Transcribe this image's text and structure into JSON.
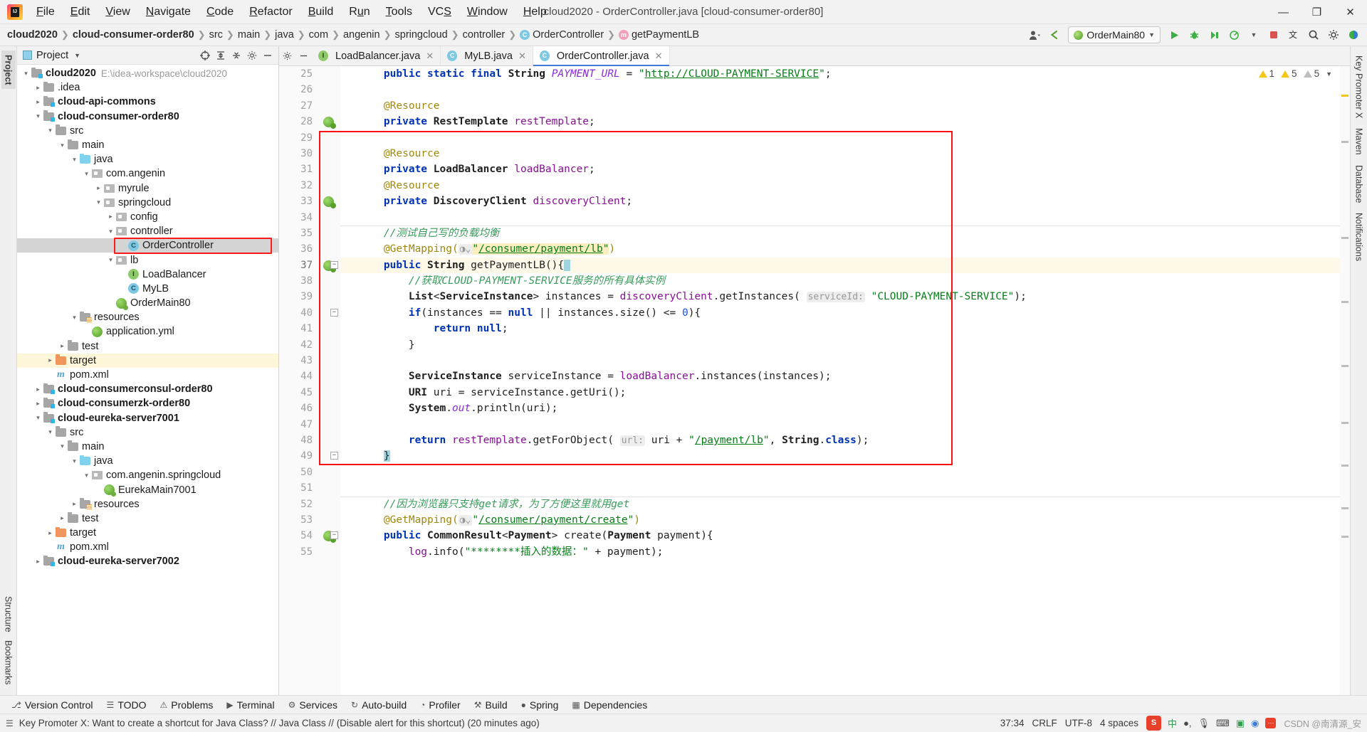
{
  "window": {
    "title": "cloud2020 - OrderController.java [cloud-consumer-order80]",
    "app_icon": "intellij-idea-logo",
    "minimize_label": "—",
    "restore_label": "❐",
    "close_label": "✕"
  },
  "menubar": [
    {
      "label": "File"
    },
    {
      "label": "Edit"
    },
    {
      "label": "View"
    },
    {
      "label": "Navigate"
    },
    {
      "label": "Code"
    },
    {
      "label": "Refactor"
    },
    {
      "label": "Build"
    },
    {
      "label": "Run"
    },
    {
      "label": "Tools"
    },
    {
      "label": "VCS"
    },
    {
      "label": "Window"
    },
    {
      "label": "Help"
    }
  ],
  "breadcrumb": [
    {
      "label": "cloud2020",
      "bold": true,
      "icon": ""
    },
    {
      "label": "cloud-consumer-order80",
      "bold": true,
      "icon": ""
    },
    {
      "label": "src",
      "bold": false,
      "icon": ""
    },
    {
      "label": "main",
      "bold": false,
      "icon": ""
    },
    {
      "label": "java",
      "bold": false,
      "icon": ""
    },
    {
      "label": "com",
      "bold": false,
      "icon": ""
    },
    {
      "label": "angenin",
      "bold": false,
      "icon": ""
    },
    {
      "label": "springcloud",
      "bold": false,
      "icon": ""
    },
    {
      "label": "controller",
      "bold": false,
      "icon": ""
    },
    {
      "label": "OrderController",
      "bold": false,
      "icon": "class-icon"
    },
    {
      "label": "getPaymentLB",
      "bold": false,
      "icon": "method-icon"
    }
  ],
  "toolbar": {
    "run_config": "OrderMain80",
    "run_label": "run-button",
    "debug_label": "debug-button",
    "coverage_label": "run-with-coverage-button",
    "profile_label": "profiler-button",
    "stop_label": "stop-button",
    "translate_label": "translate-button",
    "search_label": "search-everywhere-button",
    "settings_label": "settings-button",
    "user_label": "user-account-button",
    "updates_label": "updates-button"
  },
  "left_strip": {
    "tabs": [
      {
        "label": "Project",
        "active": true
      }
    ],
    "bottom": [
      {
        "label": "Bookmarks"
      },
      {
        "label": "Structure"
      }
    ]
  },
  "right_strip": {
    "tabs": [
      {
        "label": "Key Promoter X"
      },
      {
        "label": "Maven"
      },
      {
        "label": "Database"
      },
      {
        "label": "Notifications"
      }
    ]
  },
  "project_panel": {
    "title": "Project",
    "tools": [
      "target-icon",
      "expand-all-icon",
      "collapse-all-icon",
      "gear-icon",
      "hide-icon"
    ],
    "tree": [
      {
        "depth": 0,
        "arrow": "down",
        "icon": "module-folder",
        "label": "cloud2020",
        "bold": true,
        "sub": "E:\\idea-workspace\\cloud2020"
      },
      {
        "depth": 1,
        "arrow": "right",
        "icon": "folder",
        "label": ".idea",
        "bold": false,
        "sub": ""
      },
      {
        "depth": 1,
        "arrow": "right",
        "icon": "module-folder",
        "label": "cloud-api-commons",
        "bold": true,
        "sub": ""
      },
      {
        "depth": 1,
        "arrow": "down",
        "icon": "module-folder",
        "label": "cloud-consumer-order80",
        "bold": true,
        "sub": ""
      },
      {
        "depth": 2,
        "arrow": "down",
        "icon": "folder",
        "label": "src",
        "bold": false,
        "sub": ""
      },
      {
        "depth": 3,
        "arrow": "down",
        "icon": "folder",
        "label": "main",
        "bold": false,
        "sub": ""
      },
      {
        "depth": 4,
        "arrow": "down",
        "icon": "source-folder",
        "label": "java",
        "bold": false,
        "sub": ""
      },
      {
        "depth": 5,
        "arrow": "down",
        "icon": "package",
        "label": "com.angenin",
        "bold": false,
        "sub": ""
      },
      {
        "depth": 6,
        "arrow": "right",
        "icon": "package",
        "label": "myrule",
        "bold": false,
        "sub": ""
      },
      {
        "depth": 6,
        "arrow": "down",
        "icon": "package",
        "label": "springcloud",
        "bold": false,
        "sub": ""
      },
      {
        "depth": 7,
        "arrow": "right",
        "icon": "package",
        "label": "config",
        "bold": false,
        "sub": ""
      },
      {
        "depth": 7,
        "arrow": "down",
        "icon": "package",
        "label": "controller",
        "bold": false,
        "sub": ""
      },
      {
        "depth": 8,
        "arrow": "none",
        "icon": "class",
        "label": "OrderController",
        "bold": false,
        "sub": "",
        "selected": true,
        "outlined": true
      },
      {
        "depth": 7,
        "arrow": "down",
        "icon": "package",
        "label": "lb",
        "bold": false,
        "sub": ""
      },
      {
        "depth": 8,
        "arrow": "none",
        "icon": "interface",
        "label": "LoadBalancer",
        "bold": false,
        "sub": ""
      },
      {
        "depth": 8,
        "arrow": "none",
        "icon": "class",
        "label": "MyLB",
        "bold": false,
        "sub": ""
      },
      {
        "depth": 7,
        "arrow": "none",
        "icon": "spring-class",
        "label": "OrderMain80",
        "bold": false,
        "sub": ""
      },
      {
        "depth": 4,
        "arrow": "down",
        "icon": "resource-folder",
        "label": "resources",
        "bold": false,
        "sub": ""
      },
      {
        "depth": 5,
        "arrow": "none",
        "icon": "yml",
        "label": "application.yml",
        "bold": false,
        "sub": ""
      },
      {
        "depth": 3,
        "arrow": "right",
        "icon": "folder",
        "label": "test",
        "bold": false,
        "sub": ""
      },
      {
        "depth": 2,
        "arrow": "right",
        "icon": "folder-orange",
        "label": "target",
        "bold": false,
        "sub": "",
        "highlighted": true
      },
      {
        "depth": 2,
        "arrow": "none",
        "icon": "maven",
        "label": "pom.xml",
        "bold": false,
        "sub": ""
      },
      {
        "depth": 1,
        "arrow": "right",
        "icon": "module-folder",
        "label": "cloud-consumerconsul-order80",
        "bold": true,
        "sub": ""
      },
      {
        "depth": 1,
        "arrow": "right",
        "icon": "module-folder",
        "label": "cloud-consumerzk-order80",
        "bold": true,
        "sub": ""
      },
      {
        "depth": 1,
        "arrow": "down",
        "icon": "module-folder",
        "label": "cloud-eureka-server7001",
        "bold": true,
        "sub": ""
      },
      {
        "depth": 2,
        "arrow": "down",
        "icon": "folder",
        "label": "src",
        "bold": false,
        "sub": ""
      },
      {
        "depth": 3,
        "arrow": "down",
        "icon": "folder",
        "label": "main",
        "bold": false,
        "sub": ""
      },
      {
        "depth": 4,
        "arrow": "down",
        "icon": "source-folder",
        "label": "java",
        "bold": false,
        "sub": ""
      },
      {
        "depth": 5,
        "arrow": "down",
        "icon": "package",
        "label": "com.angenin.springcloud",
        "bold": false,
        "sub": ""
      },
      {
        "depth": 6,
        "arrow": "none",
        "icon": "spring-class",
        "label": "EurekaMain7001",
        "bold": false,
        "sub": ""
      },
      {
        "depth": 4,
        "arrow": "right",
        "icon": "resource-folder",
        "label": "resources",
        "bold": false,
        "sub": ""
      },
      {
        "depth": 3,
        "arrow": "right",
        "icon": "folder",
        "label": "test",
        "bold": false,
        "sub": ""
      },
      {
        "depth": 2,
        "arrow": "right",
        "icon": "folder-orange",
        "label": "target",
        "bold": false,
        "sub": ""
      },
      {
        "depth": 2,
        "arrow": "none",
        "icon": "maven",
        "label": "pom.xml",
        "bold": false,
        "sub": ""
      },
      {
        "depth": 1,
        "arrow": "right",
        "icon": "module-folder",
        "label": "cloud-eureka-server7002",
        "bold": true,
        "sub": ""
      }
    ]
  },
  "editor": {
    "tabs": [
      {
        "label": "LoadBalancer.java",
        "icon": "interface-icon",
        "active": false
      },
      {
        "label": "MyLB.java",
        "icon": "class-icon",
        "active": false
      },
      {
        "label": "OrderController.java",
        "icon": "class-icon",
        "active": true
      }
    ],
    "inspections": {
      "warnings": "1",
      "weak_warnings": "5",
      "greyed": "5",
      "chevron": "⌄"
    },
    "first_line_number": 25,
    "current_line": 37,
    "lines": [
      {
        "n": 25,
        "html": "    <span class=\"kw\">public</span> <span class=\"kw\">static</span> <span class=\"kw\">final</span> <span class=\"typ\">String</span> <span class=\"cnst\">PAYMENT_URL</span> = <span class=\"str\">\"</span><span class=\"strlink\">http://CLOUD-PAYMENT-SERVICE</span><span class=\"str\">\"</span>;"
      },
      {
        "n": 26,
        "html": ""
      },
      {
        "n": 27,
        "html": "    <span class=\"ann\">@Resource</span>"
      },
      {
        "n": 28,
        "html": "    <span class=\"kw\">private</span> <span class=\"typ\">RestTemplate</span> <span class=\"fld2\">restTemplate</span>;",
        "gutter_icon": "spring-bean"
      },
      {
        "n": 29,
        "html": ""
      },
      {
        "n": 30,
        "html": "    <span class=\"ann\">@Resource</span>"
      },
      {
        "n": 31,
        "html": "    <span class=\"kw\">private</span> <span class=\"typ\">LoadBalancer</span> <span class=\"fld2\">loadBalancer</span>;"
      },
      {
        "n": 32,
        "html": "    <span class=\"ann\">@Resource</span>"
      },
      {
        "n": 33,
        "html": "    <span class=\"kw\">private</span> <span class=\"typ\">DiscoveryClient</span> <span class=\"fld2\">discoveryClient</span>;",
        "gutter_icon": "spring-bean"
      },
      {
        "n": 34,
        "html": ""
      },
      {
        "n": 35,
        "html": "    <span class=\"cmt-cn\">//测试自己写的负载均衡</span>",
        "sep_above": true
      },
      {
        "n": 36,
        "html": "    <span class=\"ann\">@GetMapping(</span><span class=\"param-hint\">◑⌄</span><span class=\"hl-yellow\"><span class=\"str\">\"</span><span class=\"strlink\">/consumer/payment/lb</span><span class=\"str\">\"</span></span><span class=\"ann\">)</span>"
      },
      {
        "n": 37,
        "html": "    <span class=\"kw\">public</span> <span class=\"typ\">String</span> <span class=\"mtd\">getPaymentLB</span>(){<span class=\"caretmark\"> </span>",
        "gutter_icon": "spring-url",
        "fold": true,
        "current": true
      },
      {
        "n": 38,
        "html": "        <span class=\"cmt-cn\">//获取CLOUD-PAYMENT-SERVICE服务的所有具体实例</span>"
      },
      {
        "n": 39,
        "html": "        <span class=\"typ\">List</span>&lt;<span class=\"typ\">ServiceInstance</span>&gt; instances = <span class=\"fld2\">discoveryClient</span>.getInstances( <span class=\"param-hint\">serviceId:</span> <span class=\"str\">\"CLOUD-PAYMENT-SERVICE\"</span>);"
      },
      {
        "n": 40,
        "html": "        <span class=\"kw\">if</span>(instances == <span class=\"kw\">null</span> || instances.size() &lt;= <span class=\"num\">0</span>){",
        "fold": true
      },
      {
        "n": 41,
        "html": "            <span class=\"kw\">return</span> <span class=\"kw\">null</span>;"
      },
      {
        "n": 42,
        "html": "        }"
      },
      {
        "n": 43,
        "html": ""
      },
      {
        "n": 44,
        "html": "        <span class=\"typ\">ServiceInstance</span> serviceInstance = <span class=\"fld2\">loadBalancer</span>.instances(instances);"
      },
      {
        "n": 45,
        "html": "        <span class=\"typ\">URI</span> uri = serviceInstance.getUri();"
      },
      {
        "n": 46,
        "html": "        <span class=\"typ\">System</span>.<span class=\"cnst\">out</span>.println(uri);"
      },
      {
        "n": 47,
        "html": ""
      },
      {
        "n": 48,
        "html": "        <span class=\"kw\">return</span> <span class=\"fld2\">restTemplate</span>.getForObject( <span class=\"param-hint\">url:</span> uri + <span class=\"str\">\"</span><span class=\"strlink\">/payment/lb</span><span class=\"str\">\"</span>, <span class=\"typ\">String</span>.<span class=\"kw\">class</span>);"
      },
      {
        "n": 49,
        "html": "    <span class=\"brace-hl\">}</span>",
        "fold": true
      },
      {
        "n": 50,
        "html": ""
      },
      {
        "n": 51,
        "html": ""
      },
      {
        "n": 52,
        "html": "    <span class=\"cmt-cn\">//因为浏览器只支持get请求，为了方便这里就用get</span>",
        "sep_above": true
      },
      {
        "n": 53,
        "html": "    <span class=\"ann\">@GetMapping(</span><span class=\"param-hint\">◑⌄</span><span class=\"str\">\"</span><span class=\"strlink\">/consumer/payment/create</span><span class=\"str\">\"</span><span class=\"ann\">)</span>"
      },
      {
        "n": 54,
        "html": "    <span class=\"kw\">public</span> <span class=\"typ\">CommonResult</span>&lt;<span class=\"typ\">Payment</span>&gt; <span class=\"mtd\">create</span>(<span class=\"typ\">Payment</span> payment){",
        "gutter_icon": "spring-url",
        "fold": true
      },
      {
        "n": 55,
        "html": "        <span class=\"fld2\">log</span>.info(<span class=\"str\">\"********插入的数据：\"</span> + payment);"
      }
    ]
  },
  "bottom_tools": [
    {
      "label": "Version Control",
      "icon": "branch-icon"
    },
    {
      "label": "TODO",
      "icon": "list-icon"
    },
    {
      "label": "Problems",
      "icon": "error-icon"
    },
    {
      "label": "Terminal",
      "icon": "terminal-icon"
    },
    {
      "label": "Services",
      "icon": "services-icon"
    },
    {
      "label": "Auto-build",
      "icon": "refresh-icon"
    },
    {
      "label": "Profiler",
      "icon": "profiler-icon"
    },
    {
      "label": "Build",
      "icon": "hammer-icon"
    },
    {
      "label": "Spring",
      "icon": "spring-icon"
    },
    {
      "label": "Dependencies",
      "icon": "dependencies-icon"
    }
  ],
  "statusbar": {
    "message": "Key Promoter X: Want to create a shortcut for Java Class? // Java Class // (Disable alert for this shortcut) (20 minutes ago)",
    "message_icon": "notification-icon",
    "caret_position": "37:34",
    "line_separator": "CRLF",
    "encoding": "UTF-8",
    "indent": "4 spaces",
    "ime": {
      "logo": "S",
      "mode": "中",
      "keyboard_icon": "keyboard-icon",
      "mic_icon": "mic-icon",
      "panel_icon": "panel-icon",
      "color_icon": "color-icon",
      "more_icon": "more-icon"
    },
    "watermark": "CSDN @南清源_安"
  }
}
